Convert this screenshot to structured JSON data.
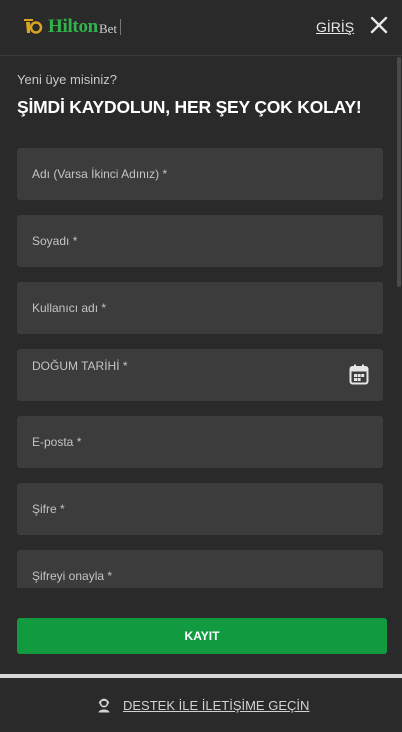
{
  "brand": {
    "logo_main": "Hilton",
    "logo_suffix": "Bet",
    "accent_color": "#129a41"
  },
  "header": {
    "login_label": "GİRİŞ",
    "close_icon": "close-icon"
  },
  "intro": {
    "subtitle": "Yeni üye misiniz?",
    "title": "ŞİMDİ KAYDOLUN, HER ŞEY ÇOK KOLAY!"
  },
  "form": {
    "fields": [
      {
        "label": "Adı (Varsa İkinci Adınız) *"
      },
      {
        "label": "Soyadı *"
      },
      {
        "label": "Kullanıcı adı *"
      },
      {
        "label": "DOĞUM TARİHİ *",
        "icon": "calendar-icon"
      },
      {
        "label": "E-posta *"
      },
      {
        "label": "Şifre *"
      },
      {
        "label": "Şifreyi onayla *"
      }
    ],
    "submit_label": "KAYIT"
  },
  "support": {
    "label": "DESTEK İLE İLETİŞİME GEÇİN",
    "icon": "support-agent-icon"
  }
}
